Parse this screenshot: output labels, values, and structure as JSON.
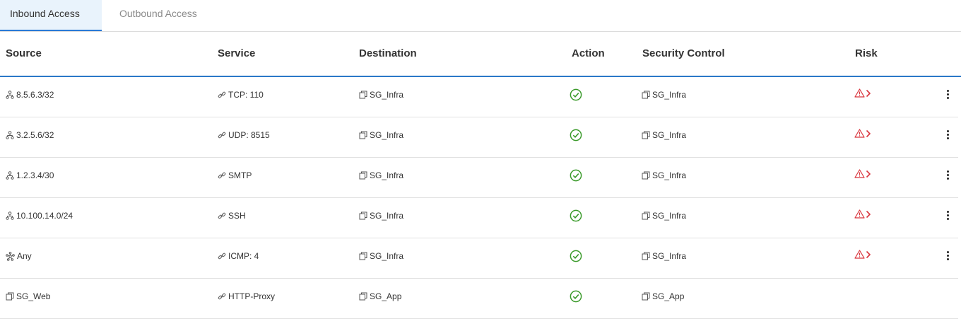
{
  "tabs": [
    {
      "label": "Inbound Access"
    },
    {
      "label": "Outbound Access"
    }
  ],
  "table": {
    "columns": [
      "Source",
      "Service",
      "Destination",
      "Action",
      "Security Control",
      "Risk"
    ],
    "rows": [
      {
        "source": "8.5.6.3/32",
        "source_icon": "network-icon",
        "service": "TCP: 110",
        "destination": "SG_Infra",
        "action": "allow",
        "security_control": "SG_Infra",
        "risk": true
      },
      {
        "source": "3.2.5.6/32",
        "source_icon": "network-icon",
        "service": "UDP: 8515",
        "destination": "SG_Infra",
        "action": "allow",
        "security_control": "SG_Infra",
        "risk": true
      },
      {
        "source": "1.2.3.4/30",
        "source_icon": "network-icon",
        "service": "SMTP",
        "destination": "SG_Infra",
        "action": "allow",
        "security_control": "SG_Infra",
        "risk": true
      },
      {
        "source": "10.100.14.0/24",
        "source_icon": "network-icon",
        "service": "SSH",
        "destination": "SG_Infra",
        "action": "allow",
        "security_control": "SG_Infra",
        "risk": true
      },
      {
        "source": "Any",
        "source_icon": "any-icon",
        "service": "ICMP: 4",
        "destination": "SG_Infra",
        "action": "allow",
        "security_control": "SG_Infra",
        "risk": true
      },
      {
        "source": "SG_Web",
        "source_icon": "security-group-icon",
        "service": "HTTP-Proxy",
        "destination": "SG_App",
        "action": "allow",
        "security_control": "SG_App",
        "risk": false
      }
    ]
  },
  "colors": {
    "accent": "#2b78c8",
    "active_tab_bg": "#e9f3fc",
    "allow_green": "#3a9a2a",
    "risk_red": "#d9363e"
  }
}
